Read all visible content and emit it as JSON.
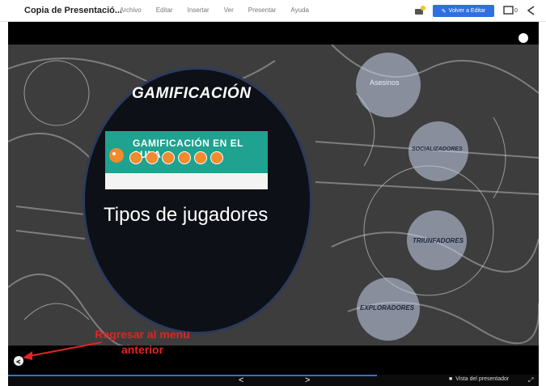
{
  "topbar": {
    "doc_title": "Copia de Presentació...",
    "menu": [
      "Archivo",
      "Editar",
      "Insertar",
      "Ver",
      "Presentar",
      "Ayuda"
    ],
    "edit_button": "Volver a Editar",
    "present_count": "0"
  },
  "slide": {
    "main_title": "GAMIFICACIÓN",
    "thumbnail_heading": "GAMIFICACIÓN EN EL AULA",
    "subtitle": "Tipos de jugadores",
    "bubbles": [
      "Asesinos",
      "SOCIALIZADORES",
      "TRIUNFADORES",
      "EXPLORADORES"
    ]
  },
  "annotation": {
    "line1": "Regresar al menu",
    "line2": "anterior"
  },
  "bottombar": {
    "prev": "<",
    "next": ">",
    "presenter_view": "Vista del presentador"
  },
  "colors": {
    "accent": "#2f6fe0",
    "annotation": "#e02424",
    "circle_bg": "#0d1016"
  }
}
